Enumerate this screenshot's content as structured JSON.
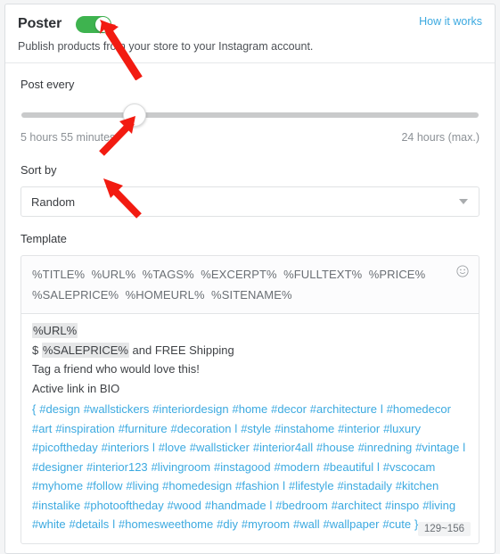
{
  "header": {
    "title": "Poster",
    "toggle_state": "on",
    "toggle_color": "#3eb34f",
    "help_link": "How it works",
    "subtitle": "Publish products from your store to your Instagram account."
  },
  "post_every": {
    "label": "Post every",
    "current_value": "5 hours 55 minutes",
    "max_value": "24 hours (max.)",
    "handle_percent": 25
  },
  "sort_by": {
    "label": "Sort by",
    "selected": "Random",
    "caret_icon": "chevron-down-icon"
  },
  "template": {
    "label": "Template",
    "tokens_line_1": "%TITLE%  %URL%  %TAGS%  %EXCERPT%  %FULLTEXT%  %PRICE%",
    "tokens_line_2": "%SALEPRICE%  %HOMEURL%  %SITENAME%",
    "emoji_icon": "smiley-icon",
    "editor": {
      "line_1_token": "%URL%",
      "line_2_prefix": "$ ",
      "line_2_token": "%SALEPRICE%",
      "line_2_suffix": " and FREE Shipping",
      "line_3": "Tag a friend who would love this!",
      "line_4": "Active link in BIO",
      "hashtags_text": "{ #design #wallstickers #interiordesign #home #decor #architecture  l  #homedecor #art #inspiration #furniture #decoration l  #style #instahome #interior #luxury #picoftheday #interiors l  #love #wallsticker #interior4all #house #inredning #vintage l  #designer #interior123 #livingroom #instagood #modern #beautiful l  #vscocam #myhome #follow #living #homedesign #fashion l  #lifestyle #instadaily #kitchen #instalike #photooftheday #wood #handmade l  #bedroom #architect #inspo #living #white #details l #homesweethome #diy #myroom #wall #wallpaper #cute }",
      "char_counter": "129~156"
    }
  },
  "annotations": {
    "arrow_color": "#f21b11",
    "arrow_1_target": "poster-toggle",
    "arrow_2_target": "post-every-slider-handle",
    "arrow_3_target": "sort-by-select"
  }
}
